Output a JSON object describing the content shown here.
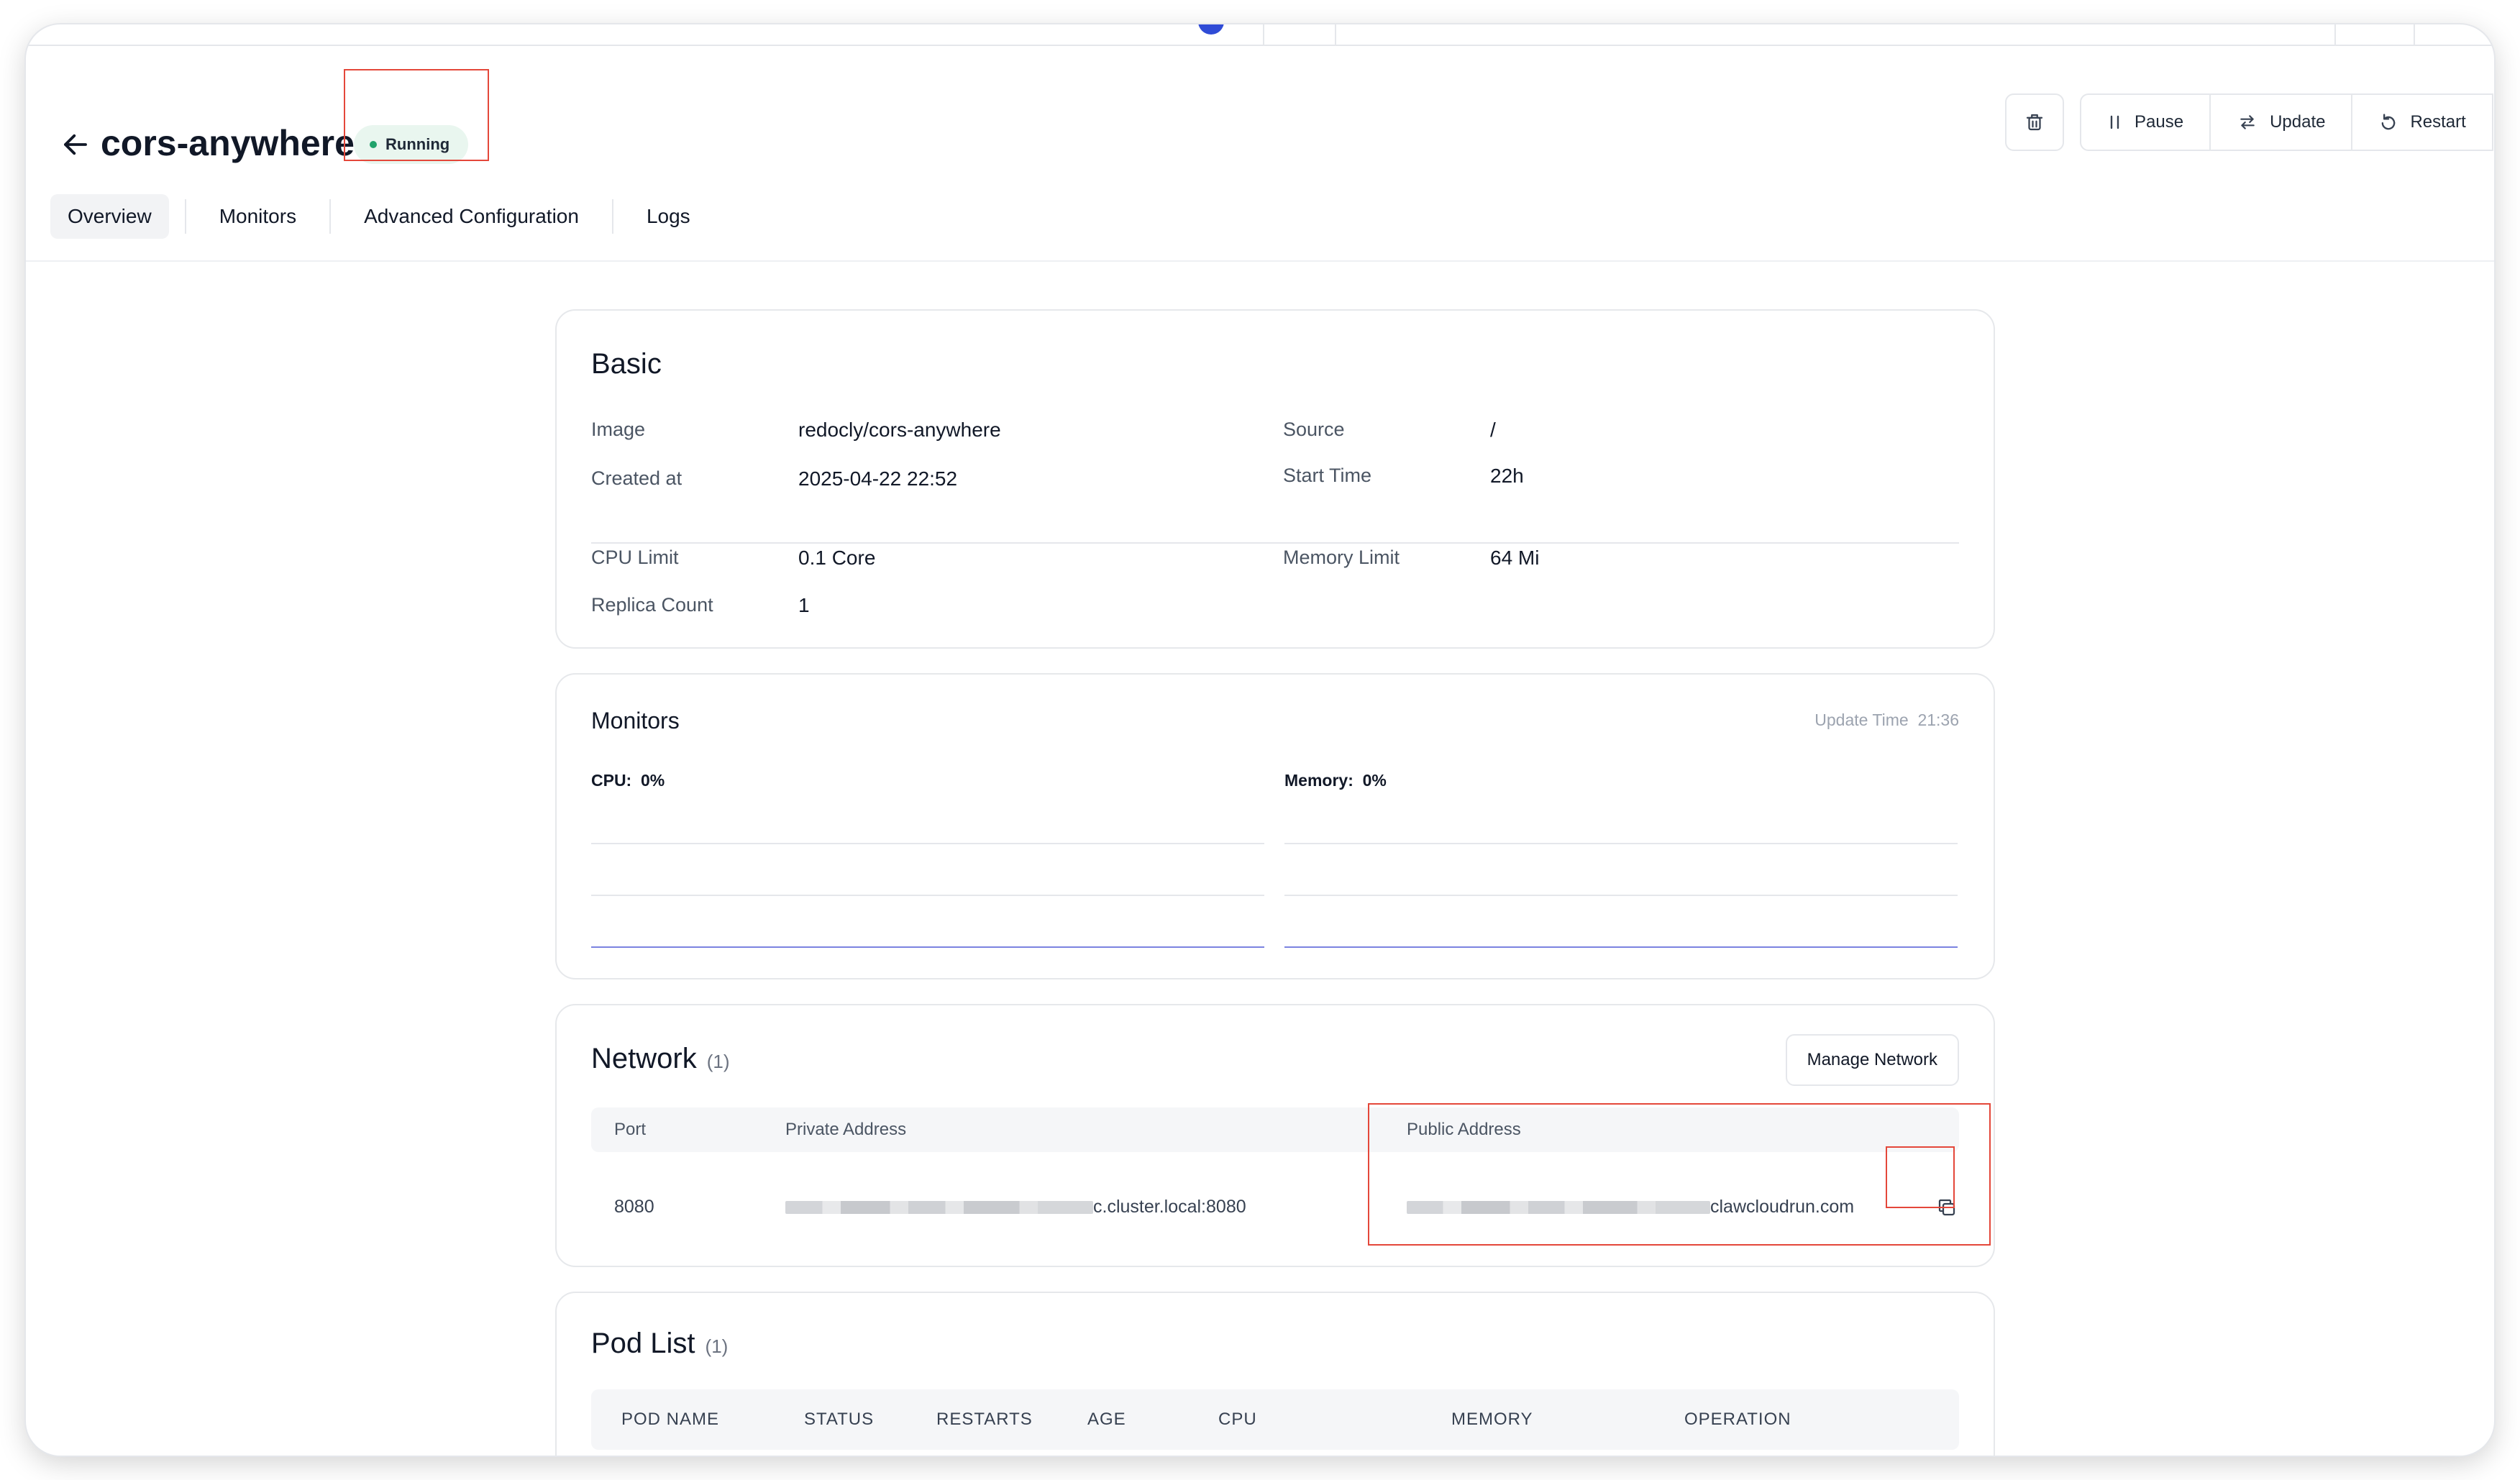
{
  "app": {
    "name": "cors-anywhere",
    "status": "Running"
  },
  "actions": {
    "pause": "Pause",
    "update": "Update",
    "restart": "Restart"
  },
  "tabs": [
    {
      "label": "Overview",
      "active": true
    },
    {
      "label": "Monitors",
      "active": false
    },
    {
      "label": "Advanced Configuration",
      "active": false
    },
    {
      "label": "Logs",
      "active": false
    }
  ],
  "basic": {
    "title": "Basic",
    "image_label": "Image",
    "image_value": "redocly/cors-anywhere",
    "created_label": "Created at",
    "created_value": "2025-04-22 22:52",
    "source_label": "Source",
    "source_value": "/",
    "start_label": "Start Time",
    "start_value": "22h",
    "cpu_label": "CPU Limit",
    "cpu_value": "0.1 Core",
    "memory_label": "Memory Limit",
    "memory_value": "64 Mi",
    "replica_label": "Replica Count",
    "replica_value": "1"
  },
  "monitors": {
    "title": "Monitors",
    "update_time_label": "Update Time",
    "update_time_value": "21:36",
    "cpu_label": "CPU:",
    "cpu_value": "0%",
    "memory_label": "Memory:",
    "memory_value": "0%"
  },
  "network": {
    "title": "Network",
    "count": "(1)",
    "manage_button": "Manage Network",
    "columns": {
      "port": "Port",
      "private": "Private Address",
      "public": "Public Address"
    },
    "rows": [
      {
        "port": "8080",
        "private_suffix": "c.cluster.local:8080",
        "public_suffix": "clawcloudrun.com"
      }
    ]
  },
  "pods": {
    "title": "Pod List",
    "count": "(1)",
    "columns": [
      "POD NAME",
      "STATUS",
      "RESTARTS",
      "AGE",
      "CPU",
      "MEMORY",
      "OPERATION"
    ]
  },
  "colors": {
    "status_dot": "#21a36b",
    "status_bg": "#e9f6ef",
    "chart_line": "#7b83e0",
    "annotation": "#e4473a"
  }
}
